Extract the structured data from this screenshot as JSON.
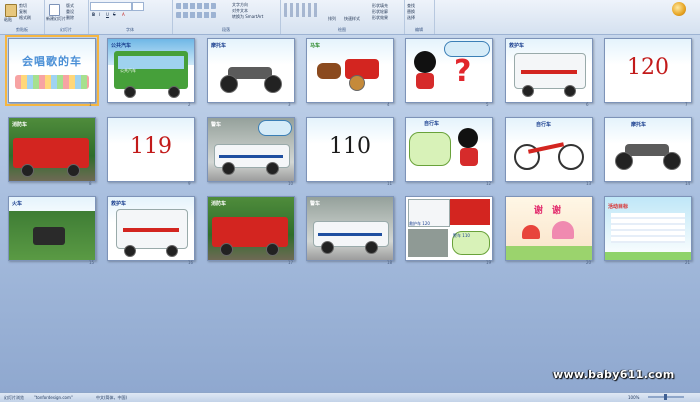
{
  "ribbon": {
    "groups": [
      {
        "label": "剪贴板",
        "items": [
          "粘贴",
          "剪切",
          "复制",
          "格式刷"
        ]
      },
      {
        "label": "幻灯片",
        "items": [
          "新建幻灯片",
          "版式",
          "重设",
          "删除"
        ]
      },
      {
        "label": "字体",
        "items": [
          "B",
          "I",
          "U",
          "S",
          "A"
        ]
      },
      {
        "label": "段落",
        "items": [
          "文字方向",
          "对齐文本",
          "转换为 SmartArt"
        ]
      },
      {
        "label": "绘图",
        "items": [
          "排列",
          "快速样式",
          "形状填充",
          "形状轮廓",
          "形状效果"
        ]
      },
      {
        "label": "编辑",
        "items": [
          "查找",
          "替换",
          "选择"
        ]
      }
    ]
  },
  "slides": [
    {
      "num": "1",
      "kind": "title",
      "text": "会唱歌的车"
    },
    {
      "num": "2",
      "kind": "bus",
      "label": "公共汽车",
      "caption": "公共汽车"
    },
    {
      "num": "3",
      "kind": "motorcycle",
      "label": "摩托车"
    },
    {
      "num": "4",
      "kind": "carriage",
      "label": "马车"
    },
    {
      "num": "5",
      "kind": "mickey-question"
    },
    {
      "num": "6",
      "kind": "ambulance",
      "label": "救护车"
    },
    {
      "num": "7",
      "kind": "number",
      "number": "120",
      "color": "#c21a1a"
    },
    {
      "num": "8",
      "kind": "firetruck",
      "label": "消防车"
    },
    {
      "num": "9",
      "kind": "number",
      "number": "119",
      "color": "#c21a1a"
    },
    {
      "num": "10",
      "kind": "police",
      "label": "警车"
    },
    {
      "num": "11",
      "kind": "number",
      "number": "110",
      "color": "#1b1b1b"
    },
    {
      "num": "12",
      "kind": "mickey",
      "label": "自行车"
    },
    {
      "num": "13",
      "kind": "bicycle",
      "label": "自行车"
    },
    {
      "num": "14",
      "kind": "motorcycle",
      "label": "摩托车"
    },
    {
      "num": "15",
      "kind": "train",
      "label": "火车"
    },
    {
      "num": "16",
      "kind": "ambulance",
      "label": "救护车"
    },
    {
      "num": "17",
      "kind": "firetruck",
      "label": "消防车"
    },
    {
      "num": "18",
      "kind": "police",
      "label": "警车"
    },
    {
      "num": "19",
      "kind": "collage",
      "label": "救护车 120",
      "label2": "警车 110"
    },
    {
      "num": "20",
      "kind": "thanks",
      "text": "谢 谢"
    },
    {
      "num": "21",
      "kind": "text",
      "text": "活动目标"
    }
  ],
  "watermark": "www.baby611.com",
  "status": {
    "slide_mode": "幻灯片浏览",
    "theme": "\"tonfordesign.com\"",
    "language": "中文(简体，中国)",
    "zoom": "100%"
  },
  "colors": {
    "accent": "#f5b642",
    "ribbon": "#d5e1f0",
    "background": "#a9bfdf"
  }
}
